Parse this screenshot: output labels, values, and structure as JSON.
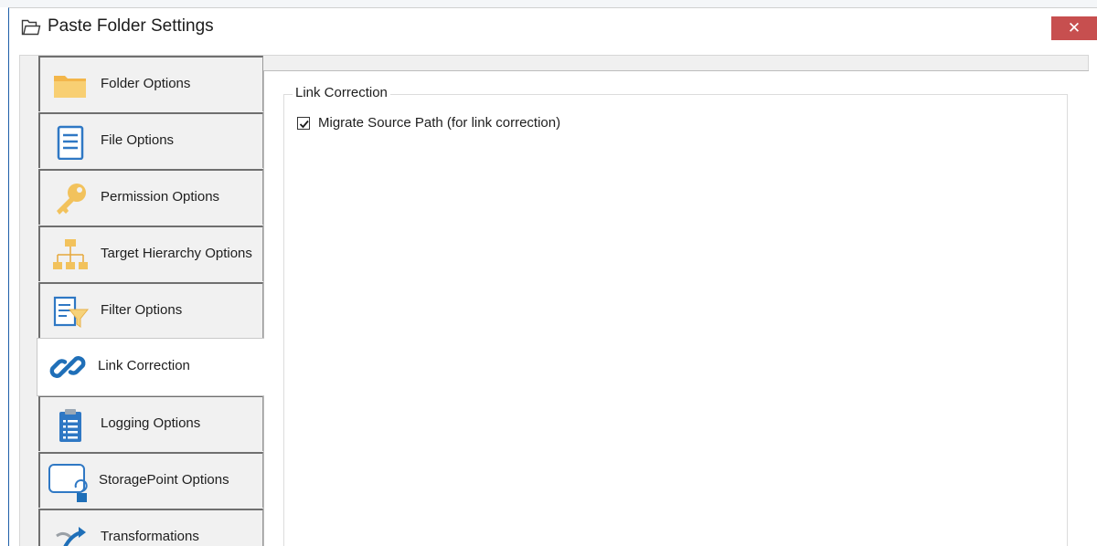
{
  "window": {
    "title": "Paste Folder Settings",
    "close_label": "✕"
  },
  "tabs": [
    {
      "label": "Folder Options",
      "icon": "folder-icon",
      "active": false
    },
    {
      "label": "File Options",
      "icon": "file-icon",
      "active": false
    },
    {
      "label": "Permission Options",
      "icon": "key-icon",
      "active": false
    },
    {
      "label": "Target Hierarchy Options",
      "icon": "hierarchy-icon",
      "active": false
    },
    {
      "label": "Filter Options",
      "icon": "filter-icon",
      "active": false
    },
    {
      "label": "Link Correction",
      "icon": "link-icon",
      "active": true
    },
    {
      "label": "Logging Options",
      "icon": "clipboard-icon",
      "active": false
    },
    {
      "label": "StoragePoint Options",
      "icon": "storagepoint-icon",
      "active": false
    },
    {
      "label": "Transformations",
      "icon": "transform-icon",
      "active": false
    }
  ],
  "content": {
    "group_title": "Link Correction",
    "migrate_source_path": {
      "label": "Migrate Source Path (for link correction)",
      "checked": true
    }
  },
  "colors": {
    "accent_blue": "#1f6fb8",
    "close_red": "#c74f4f",
    "folder_yellow": "#f6c65b"
  }
}
